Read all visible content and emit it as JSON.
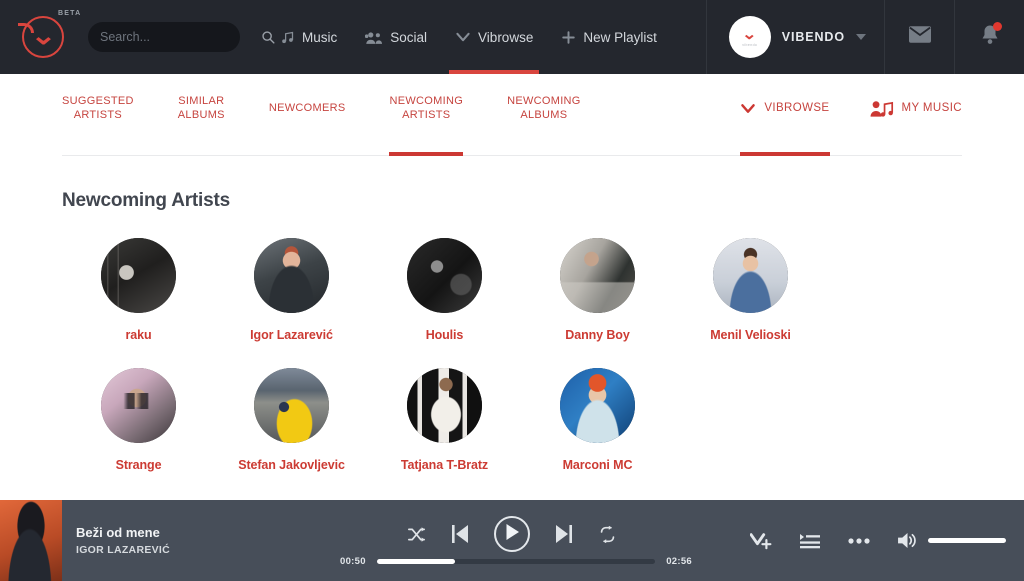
{
  "header": {
    "brand": "VIBENDO",
    "beta_label": "BETA",
    "logo_icon": "vibendo-logo-icon",
    "search": {
      "placeholder": "Search...",
      "value": "",
      "icon": "search-icon"
    },
    "nav": [
      {
        "label": "Music",
        "icon": "music-note-icon",
        "active": false
      },
      {
        "label": "Social",
        "icon": "people-group-icon",
        "active": false
      },
      {
        "label": "Vibrowse",
        "icon": "chevron-v-icon",
        "active": true
      },
      {
        "label": "New Playlist",
        "icon": "plus-icon",
        "active": false
      }
    ],
    "user": {
      "name": "VIBENDO",
      "avatar_label": "vibendo",
      "caret_icon": "chevron-down-icon"
    },
    "messages_icon": "envelope-icon",
    "notifications_icon": "bell-icon",
    "notifications_has_badge": true
  },
  "tabbar": {
    "tabs": [
      {
        "label": "SUGGESTED\nARTISTS",
        "active": false
      },
      {
        "label": "SIMILAR\nALBUMS",
        "active": false
      },
      {
        "label": "NEWCOMERS",
        "active": false
      },
      {
        "label": "NEWCOMING\nARTISTS",
        "active": true
      },
      {
        "label": "NEWCOMING\nALBUMS",
        "active": false
      }
    ],
    "right_tabs": [
      {
        "label": "VIBROWSE",
        "icon": "chevron-v-icon",
        "active": true
      },
      {
        "label": "MY MUSIC",
        "icon": "person-music-icon",
        "active": false
      }
    ]
  },
  "main": {
    "title": "Newcoming Artists",
    "artists": [
      {
        "name": "raku"
      },
      {
        "name": "Igor Lazarević"
      },
      {
        "name": "Houlis"
      },
      {
        "name": "Danny Boy"
      },
      {
        "name": "Menil Velioski"
      },
      {
        "name": "Strange"
      },
      {
        "name": "Stefan Jakovljevic"
      },
      {
        "name": "Tatjana T-Bratz"
      },
      {
        "name": "Marconi MC"
      }
    ]
  },
  "player": {
    "track_title": "Beži od mene",
    "track_artist": "IGOR LAZAREVIĆ",
    "album_art": "album-art-thumbnail",
    "controls": {
      "shuffle_icon": "shuffle-icon",
      "previous_icon": "previous-track-icon",
      "play_icon": "play-icon",
      "next_icon": "next-track-icon",
      "repeat_icon": "repeat-icon"
    },
    "time_elapsed": "00:50",
    "time_total": "02:56",
    "progress_percent": 28,
    "volume_percent": 100,
    "right_controls": {
      "add_vibe_icon": "add-to-vibrowse-icon",
      "queue_icon": "queue-list-icon",
      "more_icon": "more-options-icon",
      "volume_icon": "volume-icon"
    }
  },
  "colors": {
    "accent_red": "#cc3833",
    "header_bg": "#24272e",
    "player_bg": "#474e59",
    "title_text": "#41464f"
  }
}
